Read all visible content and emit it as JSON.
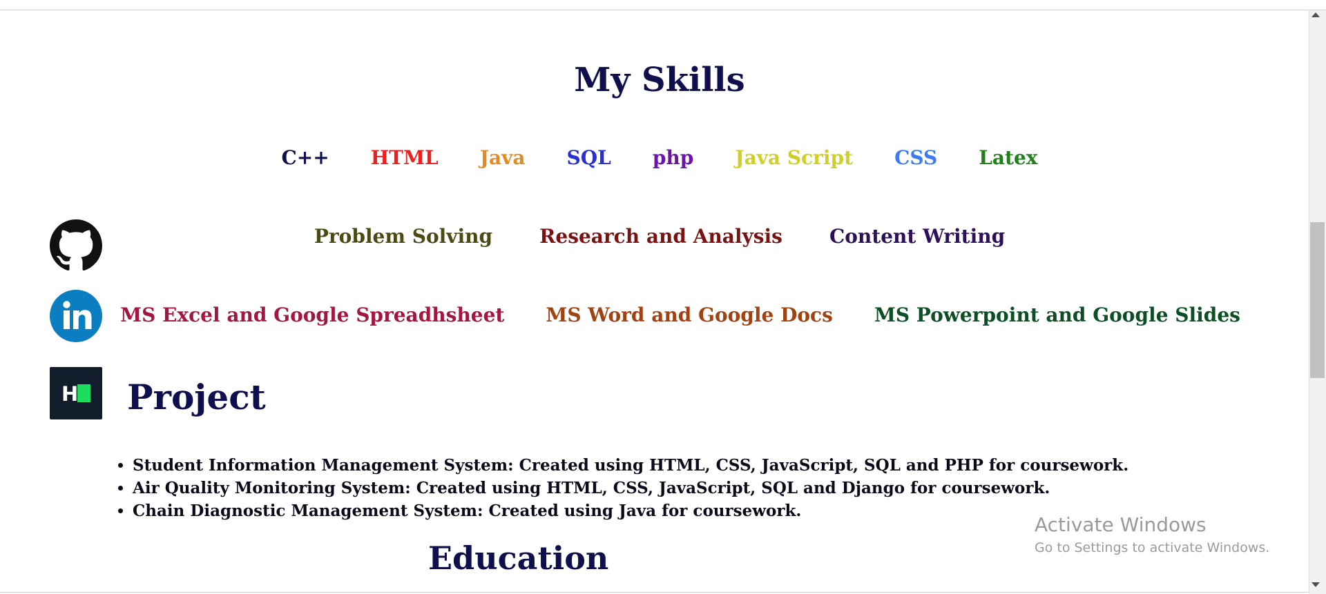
{
  "skills": {
    "title": "My Skills",
    "row1": [
      {
        "label": "C++",
        "color": "#10104d"
      },
      {
        "label": "HTML",
        "color": "#f01f1f"
      },
      {
        "label": "Java",
        "color": "#e28c25"
      },
      {
        "label": "SQL",
        "color": "#2a2fd4"
      },
      {
        "label": "php",
        "color": "#6b14a6"
      },
      {
        "label": "Java Script",
        "color": "#cfcf2a"
      },
      {
        "label": "CSS",
        "color": "#3d7bf2"
      },
      {
        "label": "Latex",
        "color": "#20801a"
      }
    ],
    "row2": [
      {
        "label": "Problem Solving",
        "color": "#4a4a12"
      },
      {
        "label": "Research and Analysis",
        "color": "#7a1212"
      },
      {
        "label": "Content Writing",
        "color": "#2e1058"
      }
    ],
    "row3": [
      {
        "label": "MS Excel and Google Spreadhsheet",
        "color": "#a3163f"
      },
      {
        "label": "MS Word and Google Docs",
        "color": "#a04212"
      },
      {
        "label": "MS Powerpoint and Google Slides",
        "color": "#0c4f24"
      }
    ]
  },
  "social": {
    "github_icon": "github-icon",
    "linkedin_icon": "linkedin-icon",
    "linkedin_color": "#0a7ec0",
    "hackerrank_icon": "hackerrank-icon",
    "hackerrank_color": "#1ddc5e",
    "hackerrank_letter": "H"
  },
  "project": {
    "title": "Project",
    "items": [
      "Student Information Management System: Created using HTML, CSS, JavaScript, SQL and PHP for coursework.",
      "Air Quality Monitoring System: Created using HTML, CSS, JavaScript, SQL and Django for coursework.",
      "Chain Diagnostic Management System: Created using Java for coursework."
    ]
  },
  "education": {
    "title": "Education"
  },
  "watermark": {
    "title": "Activate Windows",
    "subtitle": "Go to Settings to activate Windows."
  }
}
